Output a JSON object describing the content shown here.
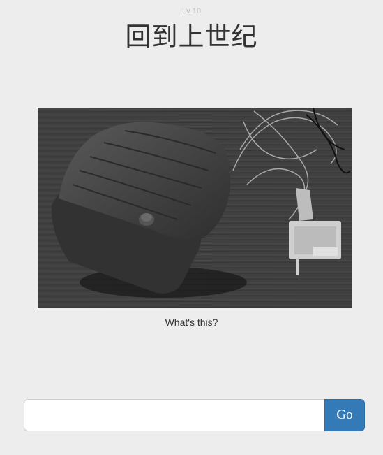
{
  "level": "Lv 10",
  "title": "回到上世纪",
  "image": {
    "icon": "vintage-computer-mouse-photo"
  },
  "caption": "What's this?",
  "form": {
    "input_value": "",
    "input_placeholder": "",
    "submit_label": "Go",
    "submit_color": "#337ab7"
  }
}
